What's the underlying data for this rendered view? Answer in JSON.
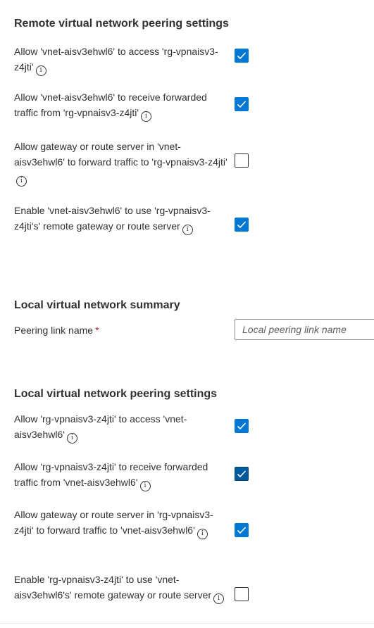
{
  "remote": {
    "heading": "Remote virtual network peering settings",
    "items": [
      {
        "label": "Allow 'vnet-aisv3ehwl6' to access 'rg-vpnaisv3-z4jti'",
        "checked": true
      },
      {
        "label": "Allow 'vnet-aisv3ehwl6' to receive forwarded traffic from 'rg-vpnaisv3-z4jti'",
        "checked": true
      },
      {
        "label": "Allow gateway or route server in 'vnet-aisv3ehwl6' to forward traffic to 'rg-vpnaisv3-z4jti'",
        "checked": false
      },
      {
        "label": "Enable 'vnet-aisv3ehwl6' to use 'rg-vpnaisv3-z4jti's' remote gateway or route server",
        "checked": true
      }
    ]
  },
  "summary": {
    "heading": "Local virtual network summary",
    "peering_link_label": "Peering link name",
    "required_marker": "*",
    "peering_link_value": "",
    "peering_link_placeholder": "Local peering link name"
  },
  "local": {
    "heading": "Local virtual network peering settings",
    "items": [
      {
        "label": "Allow 'rg-vpnaisv3-z4jti' to access 'vnet-aisv3ehwl6'",
        "checked": true
      },
      {
        "label": "Allow 'rg-vpnaisv3-z4jti' to receive forwarded traffic from 'vnet-aisv3ehwl6'",
        "checked": true
      },
      {
        "label": "Allow gateway or route server in 'rg-vpnaisv3-z4jti' to forward traffic to 'vnet-aisv3ehwl6'",
        "checked": true
      },
      {
        "label": "Enable 'rg-vpnaisv3-z4jti' to use 'vnet-aisv3ehwl6's' remote gateway or route server",
        "checked": false
      }
    ]
  },
  "icons": {
    "info": "info-icon",
    "check": "checkmark-icon"
  },
  "colors": {
    "accent": "#0078d4",
    "accent_focused": "#005a9e",
    "required": "#a4262c",
    "text": "#323130"
  }
}
